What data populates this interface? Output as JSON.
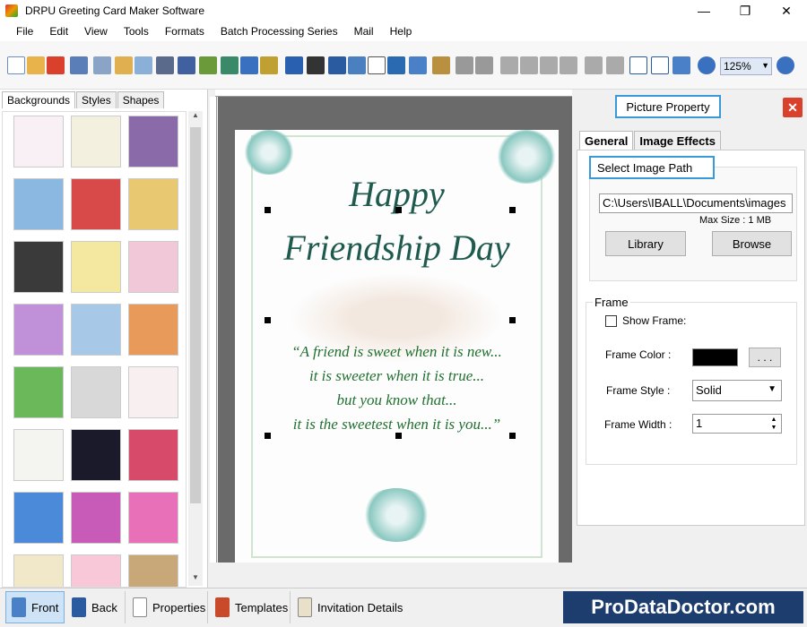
{
  "window": {
    "title": "DRPU Greeting Card Maker Software",
    "min": "—",
    "max": "❐",
    "close": "✕"
  },
  "menu": [
    "File",
    "Edit",
    "View",
    "Tools",
    "Formats",
    "Batch Processing Series",
    "Mail",
    "Help"
  ],
  "toolbar": {
    "zoom_value": "125%"
  },
  "left_tabs": [
    "Backgrounds",
    "Styles",
    "Shapes"
  ],
  "card": {
    "title_line1": "Happy",
    "title_line2": "Friendship Day",
    "quote_lines": [
      "“A friend is sweet when it is new...",
      "it is sweeter when it is true...",
      "but you know that...",
      "it is the sweetest when it is you...”"
    ]
  },
  "right_panel": {
    "header": "Picture Property",
    "tabs": [
      "General",
      "Image Effects"
    ],
    "select_image_path": "Select Image Path",
    "path_value": "C:\\Users\\IBALL\\Documents\\images",
    "max_size": "Max Size : 1 MB",
    "library_button": "Library",
    "browse_button": "Browse",
    "frame": {
      "title": "Frame",
      "show_frame": "Show Frame:",
      "frame_color_label": "Frame Color :",
      "frame_color": "#000000",
      "dots": ". . .",
      "frame_style_label": "Frame Style :",
      "frame_style": "Solid",
      "frame_width_label": "Frame Width :",
      "frame_width": "1"
    }
  },
  "bottom": {
    "front": "Front",
    "back": "Back",
    "properties": "Properties",
    "templates": "Templates",
    "invitation": "Invitation Details",
    "brand": "ProDataDoctor.com"
  }
}
